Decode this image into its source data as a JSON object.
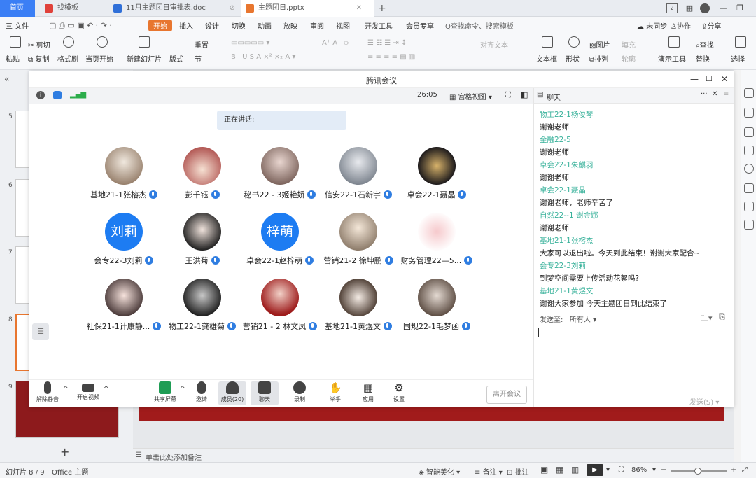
{
  "tabs": [
    {
      "label": "首页"
    },
    {
      "label": "找模板"
    },
    {
      "label": "11月主题团日审批表.doc"
    },
    {
      "label": "主题团日.pptx"
    }
  ],
  "tabbar": {
    "add": "+"
  },
  "menu": {
    "file": "三 文件",
    "items": [
      "开始",
      "插入",
      "设计",
      "切换",
      "动画",
      "放映",
      "审阅",
      "视图",
      "开发工具",
      "会员专享"
    ],
    "search": "Q查找命令、搜索模板",
    "sync": "未同步",
    "collab": "协作",
    "share": "分享"
  },
  "toolbar": {
    "paste": "粘贴",
    "cut": "剪切",
    "copy": "复制",
    "format_painter": "格式刷",
    "play": "当页开始",
    "new_slide": "新建幻灯片",
    "layout": "版式",
    "section": "节",
    "reset": "重置",
    "text_dir": "对齐文本",
    "textbox": "文本框",
    "shape": "形状",
    "picture": "图片",
    "arrange": "排列",
    "fill": "填充",
    "outline": "轮廓",
    "present_tool": "演示工具",
    "find": "查找",
    "replace": "替换",
    "select": "选择"
  },
  "slides": [
    {
      "num": "5"
    },
    {
      "num": "6"
    },
    {
      "num": "7"
    },
    {
      "num": "8"
    },
    {
      "num": "9"
    }
  ],
  "meeting": {
    "title": "腾讯会议",
    "timer": "26:05",
    "view": "宫格视图",
    "speaking": "正在讲话:",
    "participants": [
      {
        "name": "基地21-1张榕杰",
        "avatar_text": ""
      },
      {
        "name": "彭千钰",
        "avatar_text": ""
      },
      {
        "name": "秘书22 - 3姬艳娇",
        "avatar_text": ""
      },
      {
        "name": "信安22-1石新宇",
        "avatar_text": ""
      },
      {
        "name": "卓会22-1聂晶",
        "avatar_text": ""
      },
      {
        "name": "会专22-3刘莉",
        "avatar_text": "刘莉"
      },
      {
        "name": "王洪菊",
        "avatar_text": ""
      },
      {
        "name": "卓会22-1赵梓萌",
        "avatar_text": "梓萌"
      },
      {
        "name": "营销21-2 徐坤鹏",
        "avatar_text": ""
      },
      {
        "name": "财务管理22—5...",
        "avatar_text": ""
      },
      {
        "name": "社保21-1计康静...",
        "avatar_text": ""
      },
      {
        "name": "物工22-1龚雄菊",
        "avatar_text": ""
      },
      {
        "name": "营销21 - 2 林文凤",
        "avatar_text": ""
      },
      {
        "name": "基地21-1黄煜文",
        "avatar_text": ""
      },
      {
        "name": "国规22-1毛梦函",
        "avatar_text": ""
      }
    ],
    "controls": {
      "unmute": "解除静音",
      "video": "开启视频",
      "share": "共享屏幕",
      "invite": "邀请",
      "members": "成员(20)",
      "chat": "聊天",
      "record": "录制",
      "raise": "举手",
      "apps": "应用",
      "settings": "设置",
      "leave": "离开会议"
    },
    "chat": {
      "title": "聊天",
      "messages": [
        {
          "name": "物工22-1杨俊琴",
          "text": "谢谢老师"
        },
        {
          "name": "金融22-5",
          "text": "谢谢老师"
        },
        {
          "name": "卓会22-1朱麒羽",
          "text": "谢谢老师"
        },
        {
          "name": "卓会22-1聂晶",
          "text": "谢谢老师，老师辛苦了"
        },
        {
          "name": "自然22--1 谢金娜",
          "text": "谢谢老师"
        },
        {
          "name": "基地21-1张榕杰",
          "text": "大家可以退出啦。今天到此结束！谢谢大家配合~"
        },
        {
          "name": "会专22-3刘莉",
          "text": "到梦空间需要上传活动花絮吗?"
        },
        {
          "name": "基地21-1黄煜文",
          "text": "谢谢大家参加 今天主题团日到此结束了"
        }
      ],
      "send_to_label": "发送至:",
      "send_to_value": "所有人",
      "send_button": "发送(S)"
    }
  },
  "notes_placeholder": "单击此处添加备注",
  "status": {
    "slide": "幻灯片 8 / 9",
    "theme": "Office 主题",
    "beautify": "智能美化",
    "notes": "备注",
    "comments": "批注",
    "zoom": "86%"
  },
  "colors": {
    "accent": "#3b7ff5",
    "ribbon_active": "#e8762f",
    "chat_name": "#39b29b",
    "avatar_blue": "#1d7cf2"
  }
}
